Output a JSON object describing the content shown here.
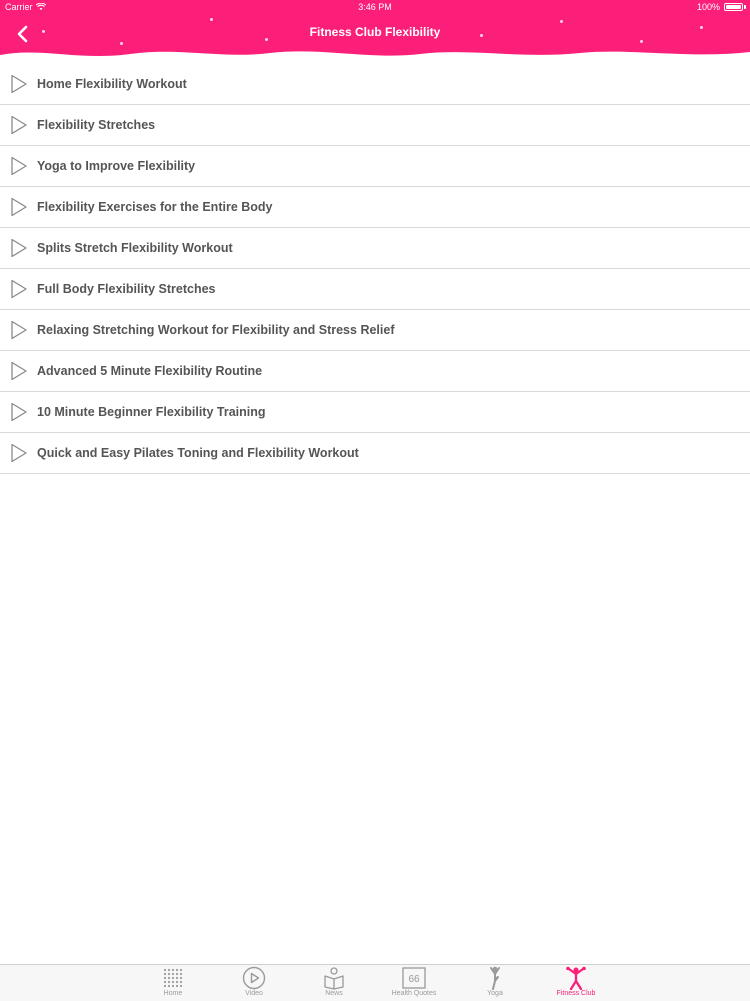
{
  "status": {
    "carrier": "Carrier",
    "time": "3:46 PM",
    "battery": "100%"
  },
  "nav": {
    "title": "Fitness Club Flexibility"
  },
  "colors": {
    "brand": "#fb1f7a",
    "text": "#555555",
    "tab_inactive": "#9a9a9a"
  },
  "list": [
    {
      "title": "Home Flexibility Workout",
      "icon": "play-outline-icon"
    },
    {
      "title": "Flexibility Stretches",
      "icon": "play-outline-icon"
    },
    {
      "title": "Yoga to Improve Flexibility",
      "icon": "play-outline-icon"
    },
    {
      "title": "Flexibility Exercises for the Entire Body",
      "icon": "play-outline-icon"
    },
    {
      "title": "Splits Stretch Flexibility Workout",
      "icon": "play-outline-icon"
    },
    {
      "title": "Full Body Flexibility Stretches",
      "icon": "play-outline-icon"
    },
    {
      "title": "Relaxing Stretching Workout for Flexibility and Stress Relief",
      "icon": "play-outline-icon"
    },
    {
      "title": "Advanced 5 Minute Flexibility Routine",
      "icon": "play-outline-icon"
    },
    {
      "title": "10 Minute Beginner Flexibility Training",
      "icon": "play-outline-icon"
    },
    {
      "title": "Quick and Easy Pilates Toning and Flexibility Workout",
      "icon": "play-outline-icon"
    }
  ],
  "tabs": [
    {
      "label": "Home",
      "icon": "dot-grid-icon",
      "active": false
    },
    {
      "label": "Video",
      "icon": "play-circle-icon",
      "active": false
    },
    {
      "label": "News",
      "icon": "news-reader-icon",
      "active": false
    },
    {
      "label": "Health Quotes",
      "icon": "quote-icon",
      "active": false,
      "glyph": "66"
    },
    {
      "label": "Yoga",
      "icon": "yoga-pose-icon",
      "active": false
    },
    {
      "label": "Fitness Club",
      "icon": "fitness-figure-icon",
      "active": true
    }
  ]
}
